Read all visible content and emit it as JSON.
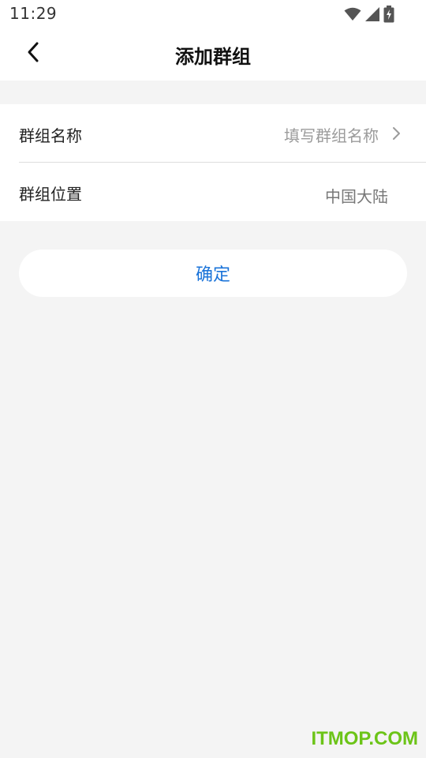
{
  "status_bar": {
    "time": "11:29",
    "icons": [
      "wifi-icon",
      "cell-signal-icon",
      "battery-charging-icon"
    ]
  },
  "nav": {
    "title": "添加群组",
    "back_icon": "chevron-left-icon"
  },
  "form": {
    "name_label": "群组名称",
    "name_placeholder": "填写群组名称",
    "location_label": "群组位置",
    "location_value": "中国大陆"
  },
  "confirm_button": {
    "label": "确定"
  },
  "watermark": "ITMOP.COM",
  "colors": {
    "accent": "#1a73d9",
    "background": "#f4f4f4",
    "watermark": "#6cc418"
  }
}
